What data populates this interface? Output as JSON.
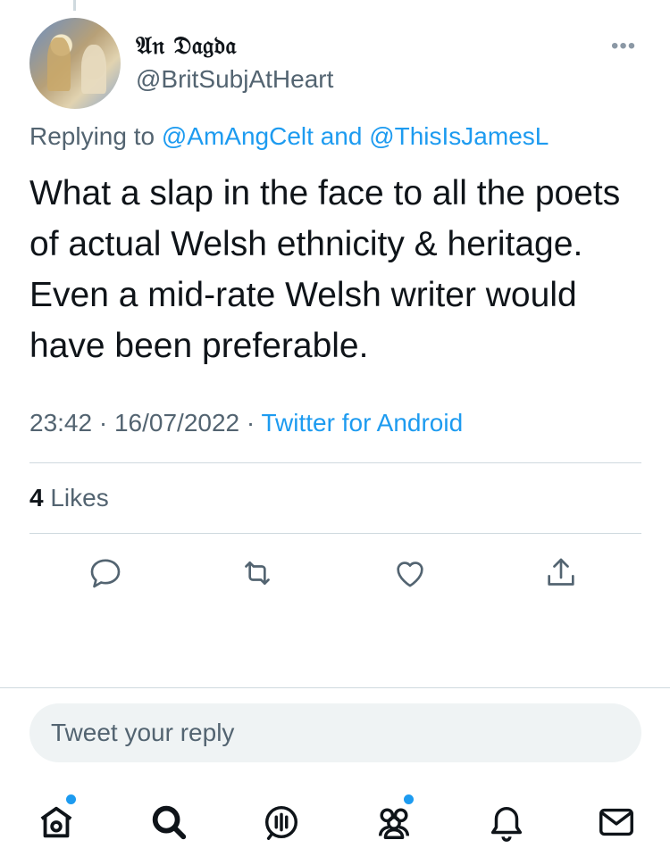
{
  "user": {
    "display_name": "𝔄𝔫 𝔇𝔞𝔤𝔡𝔞",
    "handle": "@BritSubjAtHeart"
  },
  "more_label": "•••",
  "replying": {
    "prefix": "Replying to ",
    "user1": "@AmAngCelt",
    "conjunction": " and ",
    "user2": "@ThisIsJamesL"
  },
  "tweet": {
    "text": "What a slap in the face to all the poets of actual Welsh ethnicity & heritage. Even a mid-rate Welsh writer would have been preferable.",
    "time": "23:42",
    "separator": " · ",
    "date": "16/07/2022",
    "separator2": " · ",
    "source": "Twitter for Android"
  },
  "stats": {
    "likes_count": "4",
    "likes_label": " Likes"
  },
  "actions": [
    "reply-icon",
    "retweet-icon",
    "like-icon",
    "share-icon"
  ],
  "reply_box": {
    "placeholder": "Tweet your reply"
  },
  "nav": [
    "home-icon",
    "search-icon",
    "spaces-icon",
    "communities-icon",
    "notifications-icon",
    "messages-icon"
  ],
  "colors": {
    "accent": "#1d9bf0",
    "secondary_text": "#536471",
    "primary_text": "#0f1419"
  }
}
